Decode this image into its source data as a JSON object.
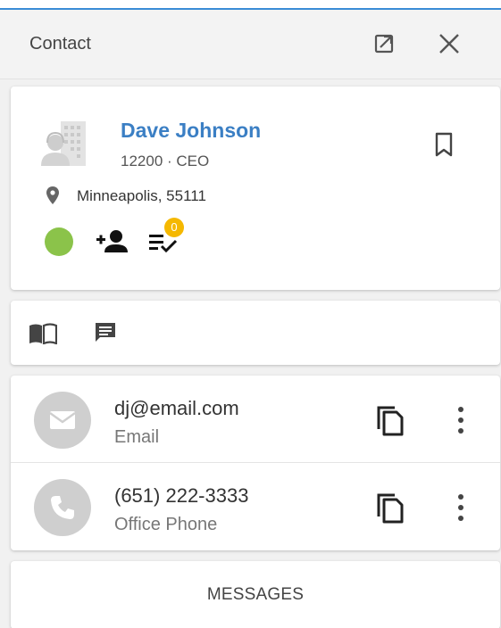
{
  "header": {
    "title": "Contact"
  },
  "contact": {
    "name": "Dave Johnson",
    "subline": "12200 · CEO",
    "location": "Minneapolis, 55111",
    "status_color": "#8bc34a",
    "task_count": "0"
  },
  "details": [
    {
      "value": "dj@email.com",
      "label": "Email",
      "icon": "email-icon"
    },
    {
      "value": "(651) 222-3333",
      "label": "Office Phone",
      "icon": "phone-icon"
    }
  ],
  "messages": {
    "label": "MESSAGES"
  },
  "colors": {
    "accent": "#3a8cd6",
    "name": "#3b7fc4",
    "badge": "#f5b800",
    "status": "#8bc34a"
  }
}
